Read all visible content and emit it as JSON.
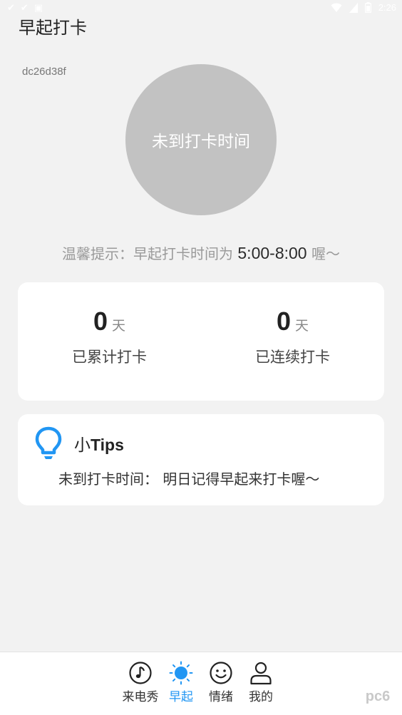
{
  "status_bar": {
    "time": "2:26"
  },
  "app": {
    "title": "早起打卡",
    "device_id": "dc26d38f"
  },
  "checkin_button": {
    "label": "未到打卡时间"
  },
  "reminder": {
    "prefix": "温馨提示：早起打卡时间为 ",
    "time_range": "5:00-8:00",
    "suffix": " 喔～"
  },
  "stats": {
    "total": {
      "value": "0",
      "unit": "天",
      "label": "已累计打卡"
    },
    "streak": {
      "value": "0",
      "unit": "天",
      "label": "已连续打卡"
    }
  },
  "tips": {
    "title_prefix": "小",
    "title_latin": "Tips",
    "body": "未到打卡时间：  明日记得早起来打卡喔～",
    "icon": "lightbulb-icon",
    "icon_color": "#2196f3"
  },
  "nav": {
    "items": [
      {
        "label": "来电秀",
        "icon": "music-note-icon"
      },
      {
        "label": "早起",
        "icon": "sun-icon",
        "active": true
      },
      {
        "label": "情绪",
        "icon": "smiley-icon"
      },
      {
        "label": "我的",
        "icon": "person-icon"
      }
    ],
    "active_color": "#2196f3"
  },
  "watermark": {
    "text": "pc6"
  }
}
